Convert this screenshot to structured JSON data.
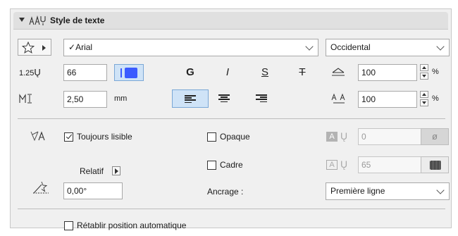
{
  "section": {
    "title": "Style de texte"
  },
  "font": {
    "name": "Arial",
    "script": "Occidental"
  },
  "size": {
    "value": "66",
    "icon_label": "1.25"
  },
  "spacing": {
    "value": "2,50",
    "unit": "mm"
  },
  "format": {
    "bold": "G",
    "italic": "I",
    "underline": "S",
    "strike": "T"
  },
  "width_factor": {
    "value": "100",
    "unit": "%"
  },
  "char_spacing": {
    "value": "100",
    "unit": "%"
  },
  "options": {
    "always_readable": "Toujours lisible",
    "opaque": "Opaque",
    "frame": "Cadre",
    "relative": "Relatif",
    "angle": "0,00°",
    "anchor_label": "Ancrage :",
    "anchor_value": "Première ligne",
    "pen_bg": "0",
    "pen_frame": "65",
    "fill_symbol": "ø",
    "reset_position": "Rétablir position automatique"
  },
  "colors": {
    "pen_swatch": "#3b5bff",
    "active_button": "#cfe3f7"
  }
}
